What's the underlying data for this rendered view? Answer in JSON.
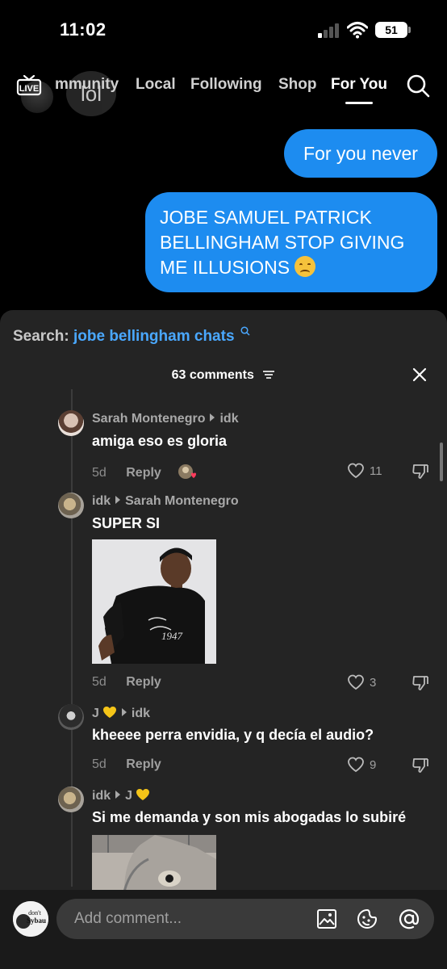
{
  "status": {
    "time": "11:02",
    "battery": "51"
  },
  "nav": {
    "story_bubble": "lol",
    "tabs": [
      {
        "label": "mmunity"
      },
      {
        "label": "Local"
      },
      {
        "label": "Following"
      },
      {
        "label": "Shop"
      },
      {
        "label": "For You"
      }
    ]
  },
  "messages": [
    {
      "text": "For you never"
    },
    {
      "text": "JOBE SAMUEL PATRICK BELLINGHAM  STOP GIVING ME ILLUSIONS"
    }
  ],
  "sheet": {
    "search_label": "Search:",
    "search_query": "jobe bellingham chats",
    "count": "63 comments",
    "replies": [
      {
        "author": "Sarah Montenegro",
        "to": "idk",
        "text": "amiga eso es gloria",
        "age": "5d",
        "reply": "Reply",
        "likes": "11"
      },
      {
        "author": "idk",
        "to": "Sarah Montenegro",
        "text": "SUPER SI",
        "age": "5d",
        "reply": "Reply",
        "likes": "3"
      },
      {
        "author": "J",
        "to": "idk",
        "text": "kheeee perra envidia, y q decía el audio?",
        "age": "5d",
        "reply": "Reply",
        "likes": "9"
      },
      {
        "author": "idk",
        "to": "J",
        "text": "Si me demanda y son mis abogadas lo subiré"
      }
    ]
  },
  "composer": {
    "placeholder": "Add comment...",
    "avatar_text_1": "don't",
    "avatar_text_2": "Sybau"
  },
  "colors": {
    "accent": "#1d8cf0",
    "link": "#4aa8ff",
    "sheet": "#242424"
  }
}
